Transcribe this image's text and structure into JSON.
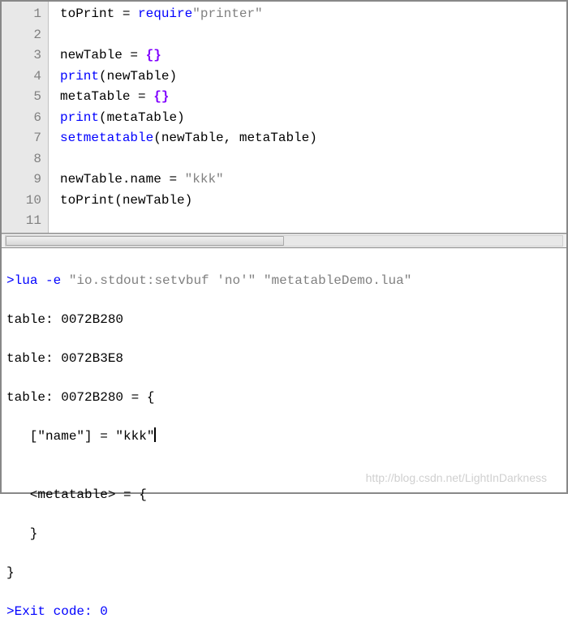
{
  "editor": {
    "lines": [
      {
        "n": "1",
        "tokens": [
          {
            "t": "toPrint ",
            "c": "tok-id"
          },
          {
            "t": "= ",
            "c": "tok-op"
          },
          {
            "t": "require",
            "c": "tok-kw"
          },
          {
            "t": "\"printer\"",
            "c": "tok-str"
          }
        ]
      },
      {
        "n": "2",
        "tokens": []
      },
      {
        "n": "3",
        "tokens": [
          {
            "t": "newTable ",
            "c": "tok-id"
          },
          {
            "t": "= ",
            "c": "tok-op"
          },
          {
            "t": "{}",
            "c": "tok-brace"
          }
        ]
      },
      {
        "n": "4",
        "tokens": [
          {
            "t": "print",
            "c": "tok-kw"
          },
          {
            "t": "(",
            "c": "tok-op"
          },
          {
            "t": "newTable",
            "c": "tok-id"
          },
          {
            "t": ")",
            "c": "tok-op"
          }
        ]
      },
      {
        "n": "5",
        "tokens": [
          {
            "t": "metaTable ",
            "c": "tok-id"
          },
          {
            "t": "= ",
            "c": "tok-op"
          },
          {
            "t": "{}",
            "c": "tok-brace"
          }
        ]
      },
      {
        "n": "6",
        "tokens": [
          {
            "t": "print",
            "c": "tok-kw"
          },
          {
            "t": "(",
            "c": "tok-op"
          },
          {
            "t": "metaTable",
            "c": "tok-id"
          },
          {
            "t": ")",
            "c": "tok-op"
          }
        ]
      },
      {
        "n": "7",
        "tokens": [
          {
            "t": "setmetatable",
            "c": "tok-kw"
          },
          {
            "t": "(",
            "c": "tok-op"
          },
          {
            "t": "newTable",
            "c": "tok-id"
          },
          {
            "t": ", ",
            "c": "tok-op"
          },
          {
            "t": "metaTable",
            "c": "tok-id"
          },
          {
            "t": ")",
            "c": "tok-op"
          }
        ]
      },
      {
        "n": "8",
        "tokens": []
      },
      {
        "n": "9",
        "tokens": [
          {
            "t": "newTable",
            "c": "tok-id"
          },
          {
            "t": ".",
            "c": "tok-dot"
          },
          {
            "t": "name ",
            "c": "tok-member"
          },
          {
            "t": "= ",
            "c": "tok-op"
          },
          {
            "t": "\"kkk\"",
            "c": "tok-str"
          }
        ]
      },
      {
        "n": "10",
        "tokens": [
          {
            "t": "toPrint",
            "c": "tok-id"
          },
          {
            "t": "(",
            "c": "tok-op"
          },
          {
            "t": "newTable",
            "c": "tok-id"
          },
          {
            "t": ")",
            "c": "tok-op"
          }
        ]
      },
      {
        "n": "11",
        "tokens": []
      }
    ]
  },
  "console": {
    "cmd_prefix": ">",
    "cmd_exe": "lua -e ",
    "cmd_arg1": "\"io.stdout:setvbuf 'no'\"",
    "cmd_space": " ",
    "cmd_arg2": "\"metatableDemo.lua\"",
    "out1": "table: 0072B280",
    "out2": "table: 0072B3E8",
    "out3": "table: 0072B280 = {",
    "out4": "   [\"name\"] = \"kkk\"",
    "out5": "",
    "out6": "   <metatable> = {",
    "out7": "   }",
    "out8": "}",
    "exit_prefix": ">",
    "exit_text": "Exit code: 0"
  },
  "watermark": "http://blog.csdn.net/LightInDarkness"
}
